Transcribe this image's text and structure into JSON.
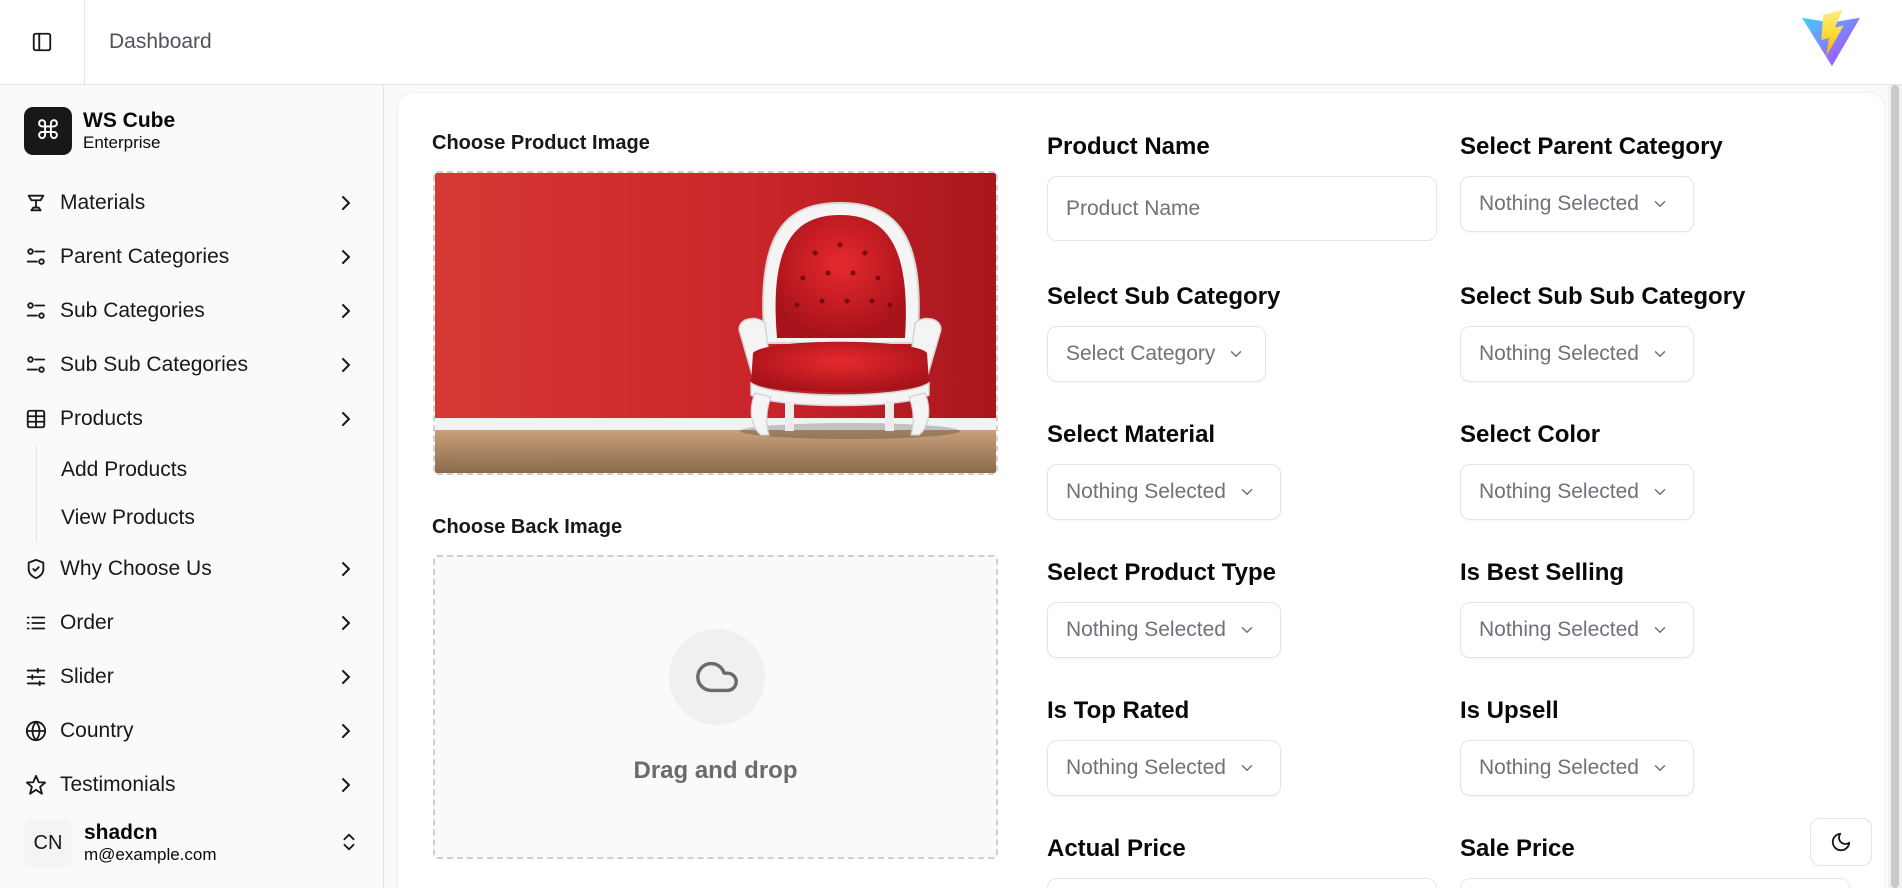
{
  "header": {
    "breadcrumb": "Dashboard"
  },
  "sidebar": {
    "team": {
      "name": "WS Cube",
      "plan": "Enterprise",
      "logo_glyph": "⌘"
    },
    "items": [
      {
        "label": "Materials",
        "icon": "material-icon"
      },
      {
        "label": "Parent Categories",
        "icon": "category-icon"
      },
      {
        "label": "Sub Categories",
        "icon": "category-icon"
      },
      {
        "label": "Sub Sub Categories",
        "icon": "category-icon"
      },
      {
        "label": "Products",
        "icon": "table-icon"
      },
      {
        "label": "Why Choose Us",
        "icon": "shield-icon"
      },
      {
        "label": "Order",
        "icon": "list-icon"
      },
      {
        "label": "Slider",
        "icon": "sliders-icon"
      },
      {
        "label": "Country",
        "icon": "globe-icon"
      },
      {
        "label": "Testimonials",
        "icon": "star-icon"
      }
    ],
    "products_sub": [
      "Add Products",
      "View Products"
    ],
    "user": {
      "initials": "CN",
      "name": "shadcn",
      "email": "m@example.com"
    }
  },
  "form": {
    "product_image_label": "Choose Product Image",
    "back_image_label": "Choose Back Image",
    "drag_drop_text": "Drag and drop",
    "product_name": {
      "label": "Product Name",
      "placeholder": "Product Name"
    },
    "parent_category": {
      "label": "Select Parent Category",
      "value": "Nothing Selected"
    },
    "sub_category": {
      "label": "Select Sub Category",
      "value": "Select Category"
    },
    "sub_sub_category": {
      "label": "Select Sub Sub Category",
      "value": "Nothing Selected"
    },
    "material": {
      "label": "Select Material",
      "value": "Nothing Selected"
    },
    "color": {
      "label": "Select Color",
      "value": "Nothing Selected"
    },
    "product_type": {
      "label": "Select Product Type",
      "value": "Nothing Selected"
    },
    "best_selling": {
      "label": "Is Best Selling",
      "value": "Nothing Selected"
    },
    "top_rated": {
      "label": "Is Top Rated",
      "value": "Nothing Selected"
    },
    "upsell": {
      "label": "Is Upsell",
      "value": "Nothing Selected"
    },
    "actual_price": {
      "label": "Actual Price"
    },
    "sale_price": {
      "label": "Sale Price"
    }
  },
  "colors": {
    "accent": "#18181b",
    "border": "#e4e4e7",
    "muted_text": "#71717a",
    "image_wall": "#c8242a"
  }
}
